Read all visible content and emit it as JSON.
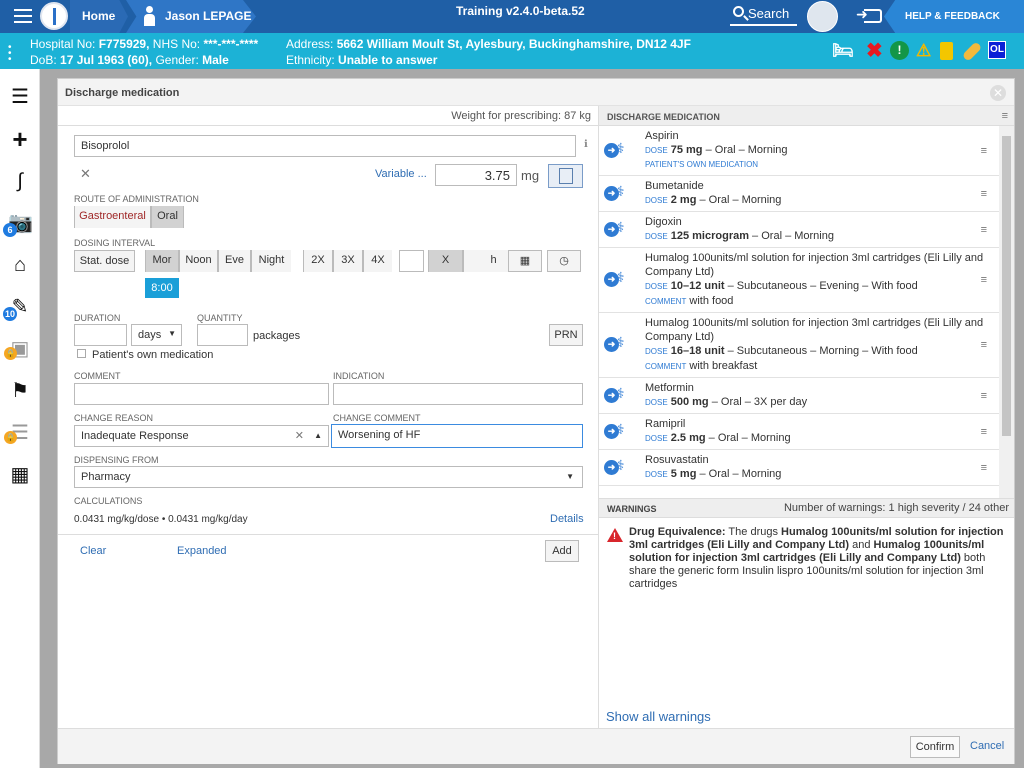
{
  "topbar": {
    "home": "Home",
    "user": "Jason LEPAGE",
    "training": "Training v2.4.0-beta.52",
    "search": "Search",
    "help": "HELP & FEEDBACK"
  },
  "patient": {
    "hospital_no_label": "Hospital No:",
    "hospital_no": "F775929,",
    "nhs_label": "NHS No:",
    "nhs": "***-***-****",
    "dob_label": "DoB:",
    "dob": "17 Jul 1963 (60),",
    "gender_label": "Gender:",
    "gender": "Male",
    "address_label": "Address:",
    "address": "5662 William Moult St, Aylesbury, Buckinghamshire, DN12 4JF",
    "ethnicity_label": "Ethnicity:",
    "ethnicity": "Unable to answer",
    "icons": [
      "bed-icon",
      "red-x-icon",
      "alert-circle-icon",
      "warning-triangle-icon",
      "bag-icon",
      "pill-icon",
      "ol-badge"
    ],
    "ol": "OL"
  },
  "sidebar": {
    "badge_camera": "6",
    "badge_notes": "10"
  },
  "modal": {
    "title": "Discharge medication",
    "weight": "Weight for prescribing: 87 kg",
    "drug": "Bisoprolol",
    "variable": "Variable ...",
    "dose": "3.75",
    "unit": "mg",
    "route_label": "ROUTE OF ADMINISTRATION",
    "routes": [
      "Gastroenteral",
      "Oral"
    ],
    "interval_label": "DOSING INTERVAL",
    "stat": "Stat. dose",
    "times": [
      "Mor",
      "Noon",
      "Eve",
      "Night"
    ],
    "freqs": [
      "2X",
      "3X",
      "4X"
    ],
    "x_label": "X",
    "h_label": "h",
    "time_tag": "8:00",
    "duration_label": "DURATION",
    "days": "days",
    "quantity_label": "QUANTITY",
    "packages": "packages",
    "prn": "PRN",
    "pom": "Patient's own medication",
    "comment_label": "COMMENT",
    "indication_label": "INDICATION",
    "change_reason_label": "CHANGE REASON",
    "change_reason": "Inadequate Response",
    "change_comment_label": "CHANGE COMMENT",
    "change_comment": "Worsening of HF",
    "dispensing_label": "DISPENSING FROM",
    "dispensing": "Pharmacy",
    "calc_label": "CALCULATIONS",
    "calc": "0.0431 mg/kg/dose • 0.0431 mg/kg/day",
    "details": "Details",
    "clear": "Clear",
    "expanded": "Expanded",
    "add": "Add",
    "confirm": "Confirm",
    "cancel": "Cancel"
  },
  "discharge": {
    "heading": "DISCHARGE MEDICATION",
    "dose_key": "DOSE",
    "comment_key": "COMMENT",
    "meds": [
      {
        "name": "Aspirin",
        "dose": "75 mg",
        "rest": " – Oral – Morning",
        "pom": "PATIENT'S OWN MEDICATION"
      },
      {
        "name": "Bumetanide",
        "dose": "2 mg",
        "rest": " – Oral – Morning"
      },
      {
        "name": "Digoxin",
        "dose": "125 microgram",
        "rest": " – Oral – Morning"
      },
      {
        "name": "Humalog 100units/ml solution for injection 3ml cartridges (Eli Lilly and Company Ltd)",
        "dose": "10–12 unit",
        "rest": " – Subcutaneous – Evening – With food",
        "comment": "with food"
      },
      {
        "name": "Humalog 100units/ml solution for injection 3ml cartridges (Eli Lilly and Company Ltd)",
        "dose": "16–18 unit",
        "rest": " – Subcutaneous – Morning – With food",
        "comment": "with breakfast"
      },
      {
        "name": "Metformin",
        "dose": "500 mg",
        "rest": " – Oral – 3X per day"
      },
      {
        "name": "Ramipril",
        "dose": "2.5 mg",
        "rest": " – Oral – Morning"
      },
      {
        "name": "Rosuvastatin",
        "dose": "5 mg",
        "rest": " – Oral – Morning"
      }
    ]
  },
  "warnings": {
    "heading": "WARNINGS",
    "count": "Number of warnings: 1 high severity / 24 other",
    "title": "Drug Equivalence:",
    "p1": " The drugs ",
    "drug1": "Humalog 100units/ml solution for injection 3ml cartridges (Eli Lilly and Company Ltd)",
    "p2": " and ",
    "drug2": "Humalog 100units/ml solution for injection 3ml cartridges (Eli Lilly and Company Ltd)",
    "p3": " both share the generic form Insulin lispro 100units/ml solution for injection 3ml cartridges",
    "show_all": "Show all warnings"
  }
}
